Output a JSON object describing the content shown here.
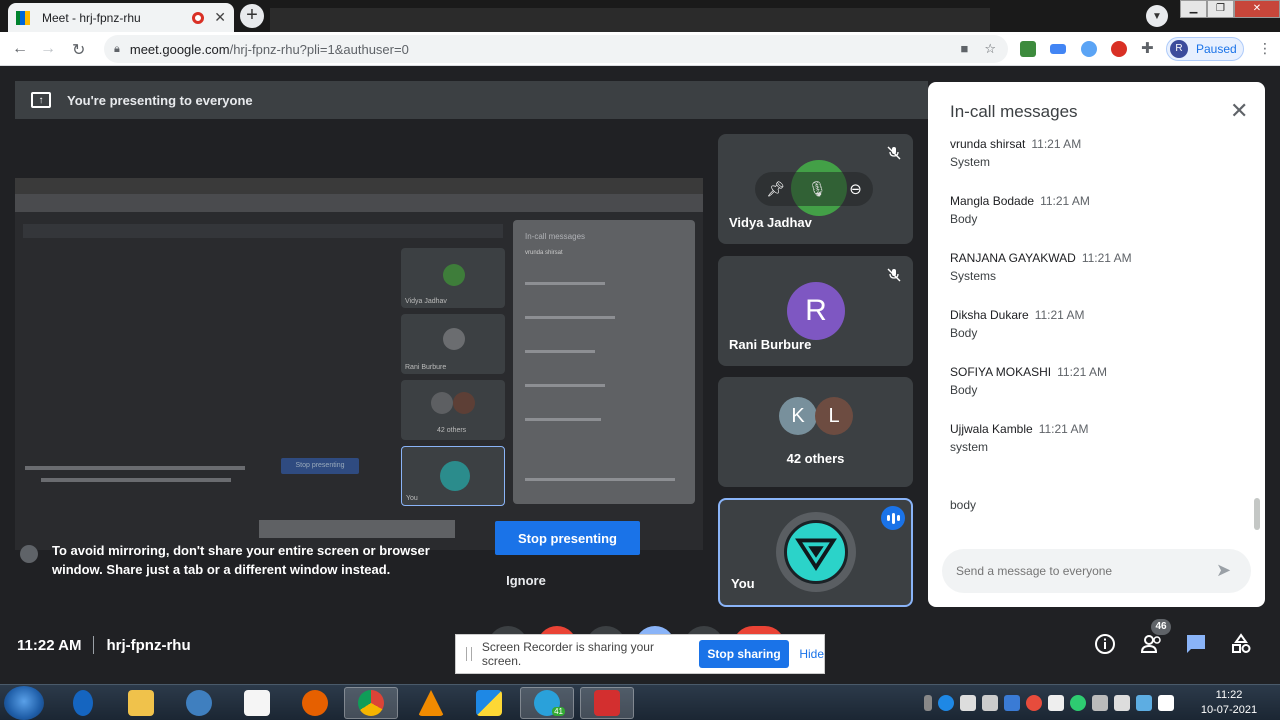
{
  "browser": {
    "tab_title": "Meet - hrj-fpnz-rhu",
    "url_host": "meet.google.com",
    "url_path": "/hrj-fpnz-rhu?pli=1&authuser=0",
    "profile_initial": "R",
    "profile_status": "Paused",
    "new_tab": "+"
  },
  "meet": {
    "presenting_banner": "You're presenting to everyone",
    "mirror_warning": "To avoid mirroring, don't share your entire screen or browser window. Share just a tab or a different window instead.",
    "stop_presenting": "Stop presenting",
    "ignore": "Ignore",
    "time": "11:22 AM",
    "meeting_code": "hrj-fpnz-rhu",
    "participants_count": "46"
  },
  "tiles": [
    {
      "name": "Vidya Jadhav",
      "initial": "",
      "color": "#43a047"
    },
    {
      "name": "Rani Burbure",
      "initial": "R",
      "color": "#7e57c2"
    },
    {
      "name": "42 others",
      "initials": [
        "K",
        "L"
      ],
      "colors": [
        "#78909c",
        "#6d4c41"
      ]
    },
    {
      "name": "You"
    }
  ],
  "chat": {
    "title": "In-call messages",
    "messages": [
      {
        "sender": "vrunda shirsat",
        "time": "11:21 AM",
        "text": "System"
      },
      {
        "sender": "Mangla Bodade",
        "time": "11:21 AM",
        "text": "Body"
      },
      {
        "sender": "RANJANA GAYAKWAD",
        "time": "11:21 AM",
        "text": "Systems"
      },
      {
        "sender": "Diksha Dukare",
        "time": "11:21 AM",
        "text": "Body"
      },
      {
        "sender": "SOFIYA MOKASHI",
        "time": "11:21 AM",
        "text": "Body"
      },
      {
        "sender": "Ujjwala Kamble",
        "time": "11:21 AM",
        "text": "system"
      }
    ],
    "extra_line": "body",
    "input_placeholder": "Send a message to everyone"
  },
  "recorder": {
    "message": "Screen Recorder is sharing your screen.",
    "stop_sharing": "Stop sharing",
    "hide": "Hide"
  },
  "mirror": {
    "chat_title": "In-call messages",
    "sender_1": "vrunda shirsat",
    "tile_1": "Vidya Jadhav",
    "tile_2": "Rani Burbure",
    "others": "42 others",
    "you": "You",
    "stop_presenting": "Stop presenting"
  },
  "taskbar": {
    "time": "11:22",
    "date": "10-07-2021",
    "telegram_badge": "41"
  },
  "colors": {
    "accent": "#1a73e8",
    "meet_bg": "#202124",
    "tile_bg": "#3c4043",
    "you_border": "#8ab4f8"
  }
}
